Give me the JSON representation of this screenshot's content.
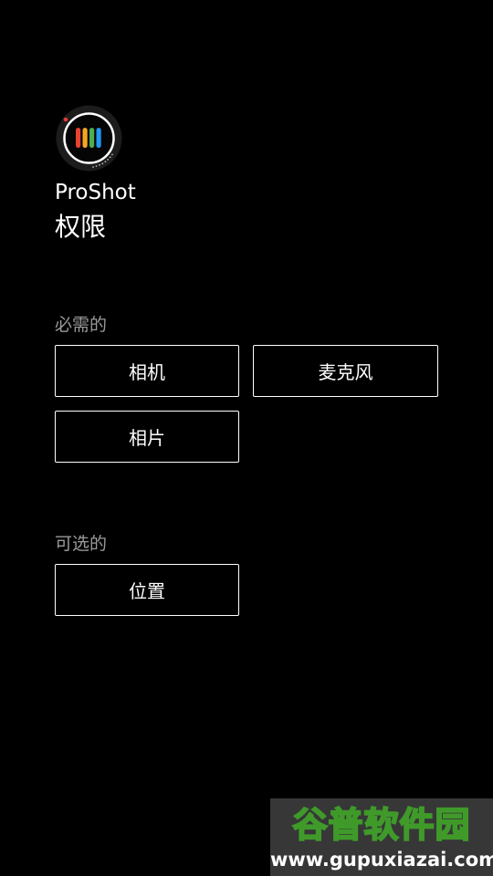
{
  "app": {
    "name": "ProShot",
    "icon": "proshot-app-icon"
  },
  "page": {
    "title": "权限"
  },
  "sections": {
    "required": {
      "label": "必需的",
      "buttons": {
        "camera": "相机",
        "microphone": "麦克风",
        "photos": "相片"
      }
    },
    "optional": {
      "label": "可选的",
      "buttons": {
        "location": "位置"
      }
    }
  },
  "watermark": {
    "title": "谷普软件园",
    "url": "www.gupuxiazai.com"
  },
  "colors": {
    "background": "#000000",
    "text": "#ffffff",
    "section_label": "#9a9a9a",
    "button_border": "#ffffff",
    "icon_bars": [
      "#e8432e",
      "#f5a623",
      "#4caf50",
      "#2196f3"
    ]
  }
}
